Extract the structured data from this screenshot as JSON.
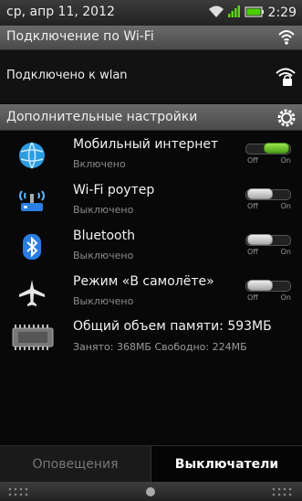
{
  "status_bar": {
    "date": "ср, апр 11, 2012",
    "time": "2:29",
    "icons": [
      "wifi-icon",
      "signal-icon",
      "battery-icon"
    ],
    "battery_color": "#4ad000"
  },
  "wifi_header": {
    "label": "Подключение по Wi-Fi",
    "icon": "wifi-icon"
  },
  "wifi_status": {
    "label": "Подключено к wlan",
    "icon": "wifi-lock-icon"
  },
  "settings_header": {
    "label": "Дополнительные настройки",
    "icon": "gear-icon"
  },
  "toggles": [
    {
      "icon": "globe-icon",
      "title": "Мобильный интернет",
      "status": "Включено",
      "state": "on",
      "off_label": "Off",
      "on_label": "On"
    },
    {
      "icon": "wifi-router-icon",
      "title": "Wi-Fi роутер",
      "status": "Выключено",
      "state": "off",
      "off_label": "Off",
      "on_label": "On"
    },
    {
      "icon": "bluetooth-icon",
      "title": "Bluetooth",
      "status": "Выключено",
      "state": "off",
      "off_label": "Off",
      "on_label": "On"
    },
    {
      "icon": "airplane-icon",
      "title": "Режим «В самолёте»",
      "status": "Выключено",
      "state": "off",
      "off_label": "Off",
      "on_label": "On"
    }
  ],
  "memory": {
    "icon": "memory-chip-icon",
    "title": "Общий объем памяти: 593МБ",
    "details": "Занято: 368МБ   Свободно: 224МБ"
  },
  "tabs": [
    {
      "label": "Оповещения",
      "active": false
    },
    {
      "label": "Выключатели",
      "active": true
    }
  ],
  "colors": {
    "toggle_on": "#6cc82a",
    "header_bg": "#5a5a5a",
    "bluetooth": "#2a7de1"
  }
}
